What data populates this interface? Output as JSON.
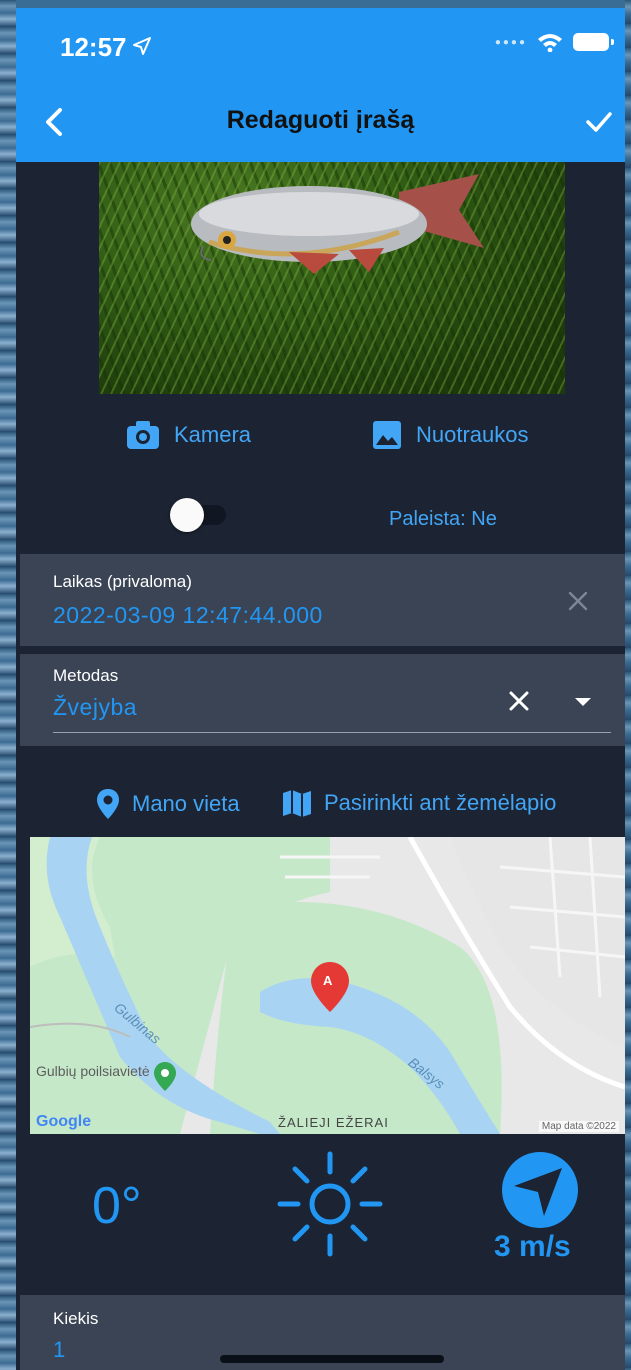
{
  "status_bar": {
    "time": "12:57"
  },
  "app_bar": {
    "title": "Redaguoti įrašą"
  },
  "media_actions": {
    "camera_label": "Kamera",
    "gallery_label": "Nuotraukos"
  },
  "released": {
    "label": "Paleista: Ne",
    "toggle_on": false
  },
  "time_field": {
    "label": "Laikas (privaloma)",
    "value": "2022-03-09 12:47:44.000"
  },
  "method_field": {
    "label": "Metodas",
    "value": "Žvejyba"
  },
  "location_actions": {
    "my_location_label": "Mano vieta",
    "pick_on_map_label": "Pasirinkti ant žemėlapio"
  },
  "map": {
    "labels": {
      "gulbinas": "Gulbinas",
      "poi": "Gulbių poilsiavietė",
      "balsys": "Balsys",
      "area": "ŽALIEJI EŽERAI",
      "google": "Google",
      "copyright": "Map data ©2022"
    },
    "marker_label": "A"
  },
  "weather": {
    "temperature": "0°",
    "wind_speed": "3 m/s"
  },
  "quantity_field": {
    "label": "Kiekis",
    "value": "1"
  },
  "colors": {
    "accent": "#2196f3",
    "background": "#1c2433",
    "field_background": "#3b4455"
  }
}
